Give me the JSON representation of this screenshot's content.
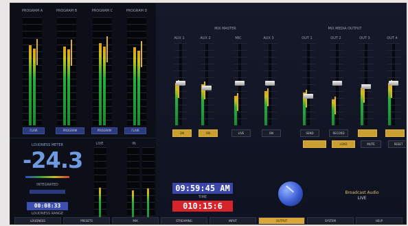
{
  "colors": {
    "accent": "#caa032",
    "clock": "#3c46a8",
    "timer": "#d8232a",
    "meter_green": "#26b03c",
    "lufs": "#6f9ae0"
  },
  "meters": {
    "labels": [
      "PROGRAM A",
      "PROGRAM B",
      "PROGRAM C",
      "PROGRAM D"
    ],
    "buttons": [
      "FLAIR",
      "PROGRAM",
      "PROGRAM",
      "FLAIR"
    ],
    "levels": [
      0.74,
      0.73,
      0.76,
      0.72
    ]
  },
  "loudness": {
    "title": "LOUDNESS METER",
    "value": "-24.3",
    "sublabel": "INTEGRATED",
    "time": "00:08:33",
    "time_label": "LOUDNESS RANGE",
    "scale_labels": [
      "LIVE",
      "IN"
    ]
  },
  "mixer": {
    "group1_label": "MIX MASTER",
    "group2_label": "MIX MEDIA OUTPUT",
    "channels": [
      "AUX 1",
      "AUX 2",
      "MIC",
      "AUX 3",
      "OUT 1",
      "OUT 2",
      "OUT 3",
      "OUT 4"
    ],
    "levels": [
      0.52,
      0.5,
      0.36,
      0.42,
      0.4,
      0.32,
      0.46,
      0.52
    ],
    "fader_positions": [
      0.46,
      0.52,
      0.46,
      0.46,
      0.62,
      0.46,
      0.5,
      0.46
    ],
    "buttons": [
      "ON",
      "ON",
      "LIVE",
      "ON",
      "SEND",
      "RECORD",
      "",
      ""
    ],
    "buttons_on": [
      true,
      true,
      false,
      false,
      false,
      false,
      true,
      true
    ],
    "buttons2": [
      "",
      "LOAD",
      "MUTE",
      "RESET"
    ],
    "buttons2_on": [
      true,
      true,
      false,
      false
    ]
  },
  "clock": {
    "time": "09:59:45 AM",
    "label": "TIME",
    "timer": "010:15:6"
  },
  "brand": {
    "name": "Broadcast Audio",
    "sub": "LIVE"
  },
  "tabs": [
    "LOUDNESS",
    "PRESETS",
    "MIX",
    "STREAMING",
    "INPUT",
    "OUTPUT",
    "SYSTEM",
    "HELP"
  ],
  "active_tab": 5
}
